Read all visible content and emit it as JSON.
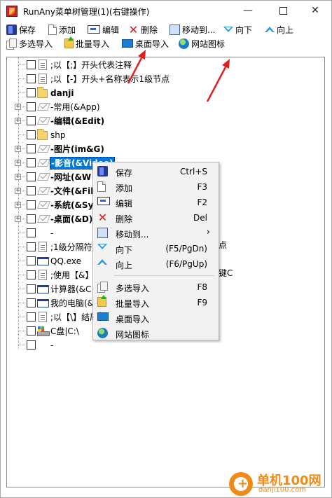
{
  "window": {
    "title": "RunAny菜单树管理(1)(右键操作)",
    "controls": {
      "minimize": "—",
      "close": "✕"
    }
  },
  "toolbar1": [
    {
      "icon": "save-icon",
      "label": "保存"
    },
    {
      "icon": "add-icon",
      "label": "添加"
    },
    {
      "icon": "edit-icon",
      "label": "编辑"
    },
    {
      "icon": "delete-icon",
      "label": "删除"
    },
    {
      "icon": "move-icon",
      "label": "移动到..."
    },
    {
      "icon": "down-icon",
      "label": "向下"
    },
    {
      "icon": "up-icon",
      "label": "向上"
    }
  ],
  "toolbar2": [
    {
      "icon": "multi-import-icon",
      "label": "多选导入"
    },
    {
      "icon": "batch-import-icon",
      "label": "批量导入"
    },
    {
      "icon": "desktop-import-icon",
      "label": "桌面导入"
    },
    {
      "icon": "website-icon-icon",
      "label": "网站图标"
    }
  ],
  "tree": [
    {
      "label": ";以【;】开头代表注释",
      "icon": "file",
      "expander": false,
      "bold": false
    },
    {
      "label": ";以【-】开头+名称表示1级节点",
      "icon": "file",
      "expander": false,
      "bold": false
    },
    {
      "label": "danji",
      "icon": "folder",
      "expander": false,
      "bold": true
    },
    {
      "label": "-常用(&App)",
      "icon": "check",
      "expander": true,
      "bold": false
    },
    {
      "label": "-编辑(&Edit)",
      "icon": "check",
      "expander": true,
      "bold": true
    },
    {
      "label": "shp",
      "icon": "folder",
      "expander": false,
      "bold": false
    },
    {
      "label": "-图片(im&G)",
      "icon": "check",
      "expander": true,
      "bold": true
    },
    {
      "label": "-影音(&Video)",
      "icon": "check",
      "expander": true,
      "bold": true,
      "selected": true
    },
    {
      "label": "-网址(&W",
      "icon": "check",
      "expander": true,
      "bold": true
    },
    {
      "label": "-文件(&Fil",
      "icon": "check",
      "expander": true,
      "bold": true
    },
    {
      "label": "-系统(&Sy",
      "icon": "check",
      "expander": true,
      "bold": true
    },
    {
      "label": "-桌面(&D)",
      "icon": "check",
      "expander": true,
      "bold": true
    },
    {
      "label": "-",
      "icon": "none",
      "expander": false,
      "bold": false
    },
    {
      "label": ";1级分隔符",
      "icon": "file",
      "expander": false,
      "bold": false
    },
    {
      "label": "QQ.exe",
      "icon": "exe",
      "expander": false,
      "bold": false
    },
    {
      "label": ";使用【&】",
      "icon": "file",
      "expander": false,
      "bold": false
    },
    {
      "label": "计算器(&C",
      "icon": "exe",
      "expander": false,
      "bold": false
    },
    {
      "label": "我的电脑(&",
      "icon": "exe",
      "expander": false,
      "bold": false
    },
    {
      "label": ";以【\\】结尾",
      "icon": "file",
      "expander": false,
      "bold": false
    },
    {
      "label": "C盘|C:\\",
      "icon": "drive",
      "expander": false,
      "bold": false
    },
    {
      "label": "-",
      "icon": "none",
      "expander": false,
      "bold": false
    }
  ],
  "tree_overflow_text": {
    "row13": "点",
    "row16": "键C"
  },
  "context_menu": [
    {
      "icon": "save-icon",
      "label": "保存",
      "shortcut": "Ctrl+S"
    },
    {
      "icon": "add-icon",
      "label": "添加",
      "shortcut": "F3"
    },
    {
      "icon": "edit-icon",
      "label": "编辑",
      "shortcut": "F2"
    },
    {
      "icon": "delete-icon",
      "label": "删除",
      "shortcut": "Del"
    },
    {
      "icon": "move-icon",
      "label": "移动到...",
      "shortcut": "",
      "submenu": "›"
    },
    {
      "icon": "down-icon",
      "label": "向下",
      "shortcut": "(F5/PgDn)"
    },
    {
      "icon": "up-icon",
      "label": "向上",
      "shortcut": "(F6/PgUp)"
    },
    {
      "separator": true
    },
    {
      "icon": "multi-import-icon",
      "label": "多选导入",
      "shortcut": "F8"
    },
    {
      "icon": "batch-import-icon",
      "label": "批量导入",
      "shortcut": "F9"
    },
    {
      "icon": "desktop-import-icon",
      "label": "桌面导入",
      "shortcut": ""
    },
    {
      "icon": "website-icon-icon",
      "label": "网站图标",
      "shortcut": ""
    }
  ],
  "watermark": {
    "text": "单机100网",
    "url": "danji100.com"
  },
  "colors": {
    "selection": "#0078d7",
    "annotation_arrow": "#e02020",
    "watermark": "#f08a18"
  }
}
